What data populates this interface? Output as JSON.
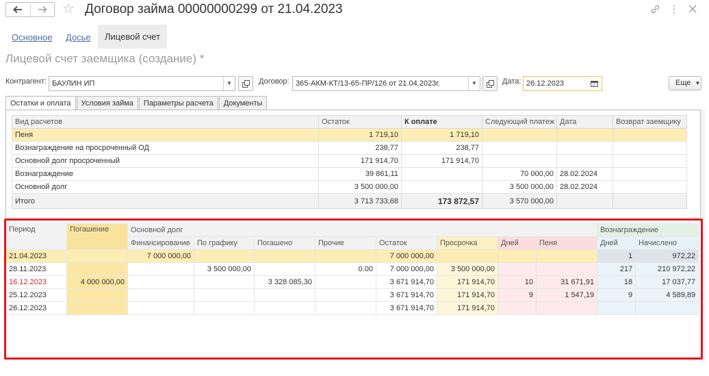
{
  "window": {
    "title": "Договор займа 00000000299 от 21.04.2023"
  },
  "sections": {
    "link1": "Основное",
    "link2": "Досье",
    "active": "Лицевой счет"
  },
  "form_title": "Лицевой счет заемщика (создание) *",
  "filters": {
    "counterparty_label": "Контрагент:",
    "counterparty_value": "БАУЛИН ИП",
    "contract_label": "Договор:",
    "contract_value": "365-АКМ-КТ/13-65-ПР/126 от 21.04.2023г.",
    "date_label": "Дата:",
    "date_value": "26.12.2023",
    "more_label": "Еще"
  },
  "tabs": [
    "Остатки и оплата",
    "Условия займа",
    "Параметры расчета",
    "Документы"
  ],
  "balances": {
    "headers": [
      "Вид расчетов",
      "Остаток",
      "К оплате",
      "Следующий платеж",
      "Дата",
      "Возврат заемщику"
    ],
    "rows": [
      [
        "Пеня",
        "1 719,10",
        "1 719,10",
        "",
        "",
        ""
      ],
      [
        "Вознаграждение на просроченный ОД",
        "238,77",
        "238,77",
        "",
        "",
        ""
      ],
      [
        "Основной долг просроченный",
        "171 914,70",
        "171 914,70",
        "",
        "",
        ""
      ],
      [
        "Вознаграждение",
        "39 861,11",
        "",
        "70 000,00",
        "28.02.2024",
        ""
      ],
      [
        "Основной долг",
        "3 500 000,00",
        "",
        "3 500 000,00",
        "28.02.2024",
        ""
      ]
    ],
    "total": [
      "Итого",
      "3 713 733,68",
      "173 872,57",
      "3 570 000,00",
      "",
      ""
    ]
  },
  "schedule": {
    "h_period": "Период",
    "h_repayment": "Погашение",
    "h_main_debt": "Основной долг",
    "h_reward": "Вознаграждение",
    "sub": [
      "Финансирование",
      "По графику",
      "Погашено",
      "Прочие",
      "Остаток",
      "Просрочка",
      "Дней",
      "Пеня",
      "Дней",
      "Начислено"
    ],
    "rows": [
      [
        "21.04.2023",
        "",
        "7 000 000,00",
        "",
        "",
        "",
        "7 000 000,00",
        "",
        "",
        "",
        "1",
        "972,22"
      ],
      [
        "28.11.2023",
        "",
        "",
        "3 500 000,00",
        "",
        "0.00",
        "7 000 000,00",
        "3 500 000,00",
        "",
        "",
        "217",
        "210 972,22"
      ],
      [
        "16.12.2023",
        "4 000 000,00",
        "",
        "",
        "3 328 085,30",
        "",
        "3 671 914,70",
        "171 914,70",
        "10",
        "31 671,91",
        "18",
        "17 037,77"
      ],
      [
        "25.12.2023",
        "",
        "",
        "",
        "",
        "",
        "3 671 914,70",
        "171 914,70",
        "9",
        "1 547,19",
        "9",
        "4 589,89"
      ],
      [
        "26.12.2023",
        "",
        "",
        "",
        "",
        "",
        "3 671 914,70",
        "171 914,70",
        "",
        "",
        "",
        ""
      ]
    ]
  },
  "colors": {
    "highlight_frame": "#e8141a",
    "selected_row": "#fbedb3",
    "overdue_date": "#d32a2a"
  }
}
